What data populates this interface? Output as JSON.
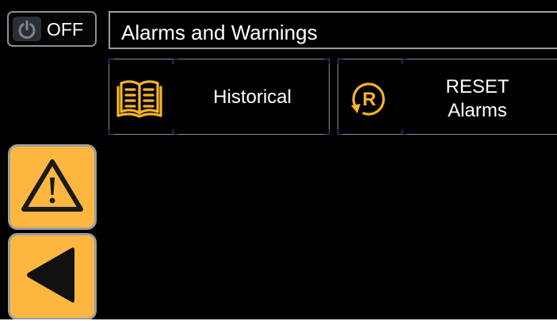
{
  "power_button": {
    "label": "OFF",
    "state": "off",
    "icon": "power-icon"
  },
  "header": {
    "title": "Alarms and Warnings"
  },
  "tiles": [
    {
      "id": "historical",
      "label": "Historical",
      "icon": "open-book-icon"
    },
    {
      "id": "reset",
      "label_line1": "RESET",
      "label_line2": "Alarms",
      "icon": "reset-r-icon"
    }
  ],
  "side_buttons": [
    {
      "id": "alarms",
      "icon": "warning-triangle-icon"
    },
    {
      "id": "back",
      "icon": "back-arrow-icon"
    }
  ],
  "colors": {
    "background": "#000000",
    "accent": "#fdb740",
    "icon_yellow": "#f5b428",
    "border": "#8b9095",
    "text": "#ffffff"
  }
}
